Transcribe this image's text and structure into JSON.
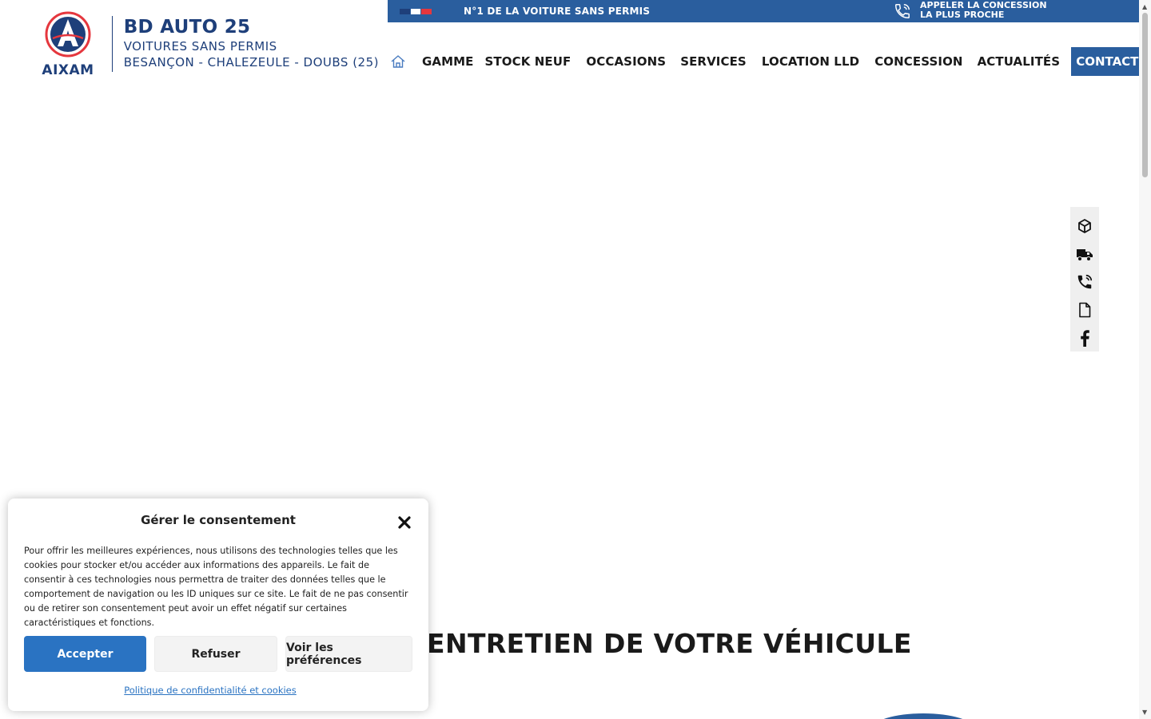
{
  "brand": {
    "logo_text": "AIXAM",
    "name": "BD AUTO 25",
    "subtitle": "VOITURES SANS PERMIS",
    "location": "BESANÇON - CHALEZEULE - DOUBS (25)"
  },
  "topbar": {
    "tagline": "N°1 DE LA VOITURE SANS PERMIS",
    "call_line1": "APPELER LA CONCESSION",
    "call_line2": "LA PLUS PROCHE",
    "flag_colors": [
      "#1e3f7a",
      "#ffffff",
      "#e5373e"
    ]
  },
  "nav": {
    "home_icon": "home-icon",
    "items": [
      "GAMME",
      "STOCK NEUF",
      "OCCASIONS",
      "SERVICES",
      "LOCATION LLD",
      "CONCESSION",
      "ACTUALITÉS"
    ],
    "contact": "CONTACT"
  },
  "side_toolbar": {
    "icons": [
      "cube-icon",
      "delivery-truck-icon",
      "phone-call-icon",
      "document-icon",
      "facebook-icon"
    ]
  },
  "main": {
    "section_title": "ENTRETIEN DE VOTRE VÉHICULE"
  },
  "consent": {
    "title": "Gérer le consentement",
    "body": "Pour offrir les meilleures expériences, nous utilisons des technologies telles que les cookies pour stocker et/ou accéder aux informations des appareils. Le fait de consentir à ces technologies nous permettra de traiter des données telles que le comportement de navigation ou les ID uniques sur ce site. Le fait de ne pas consentir ou de retirer son consentement peut avoir un effet négatif sur certaines caractéristiques et fonctions.",
    "accept": "Accepter",
    "refuse": "Refuser",
    "preferences": "Voir les préférences",
    "policy_link": "Politique de confidentialité et cookies"
  },
  "colors": {
    "brand_blue": "#2a5e9e",
    "dark_blue": "#1e3f7a",
    "accept_blue": "#2a73c2",
    "logo_red": "#e5373e"
  }
}
